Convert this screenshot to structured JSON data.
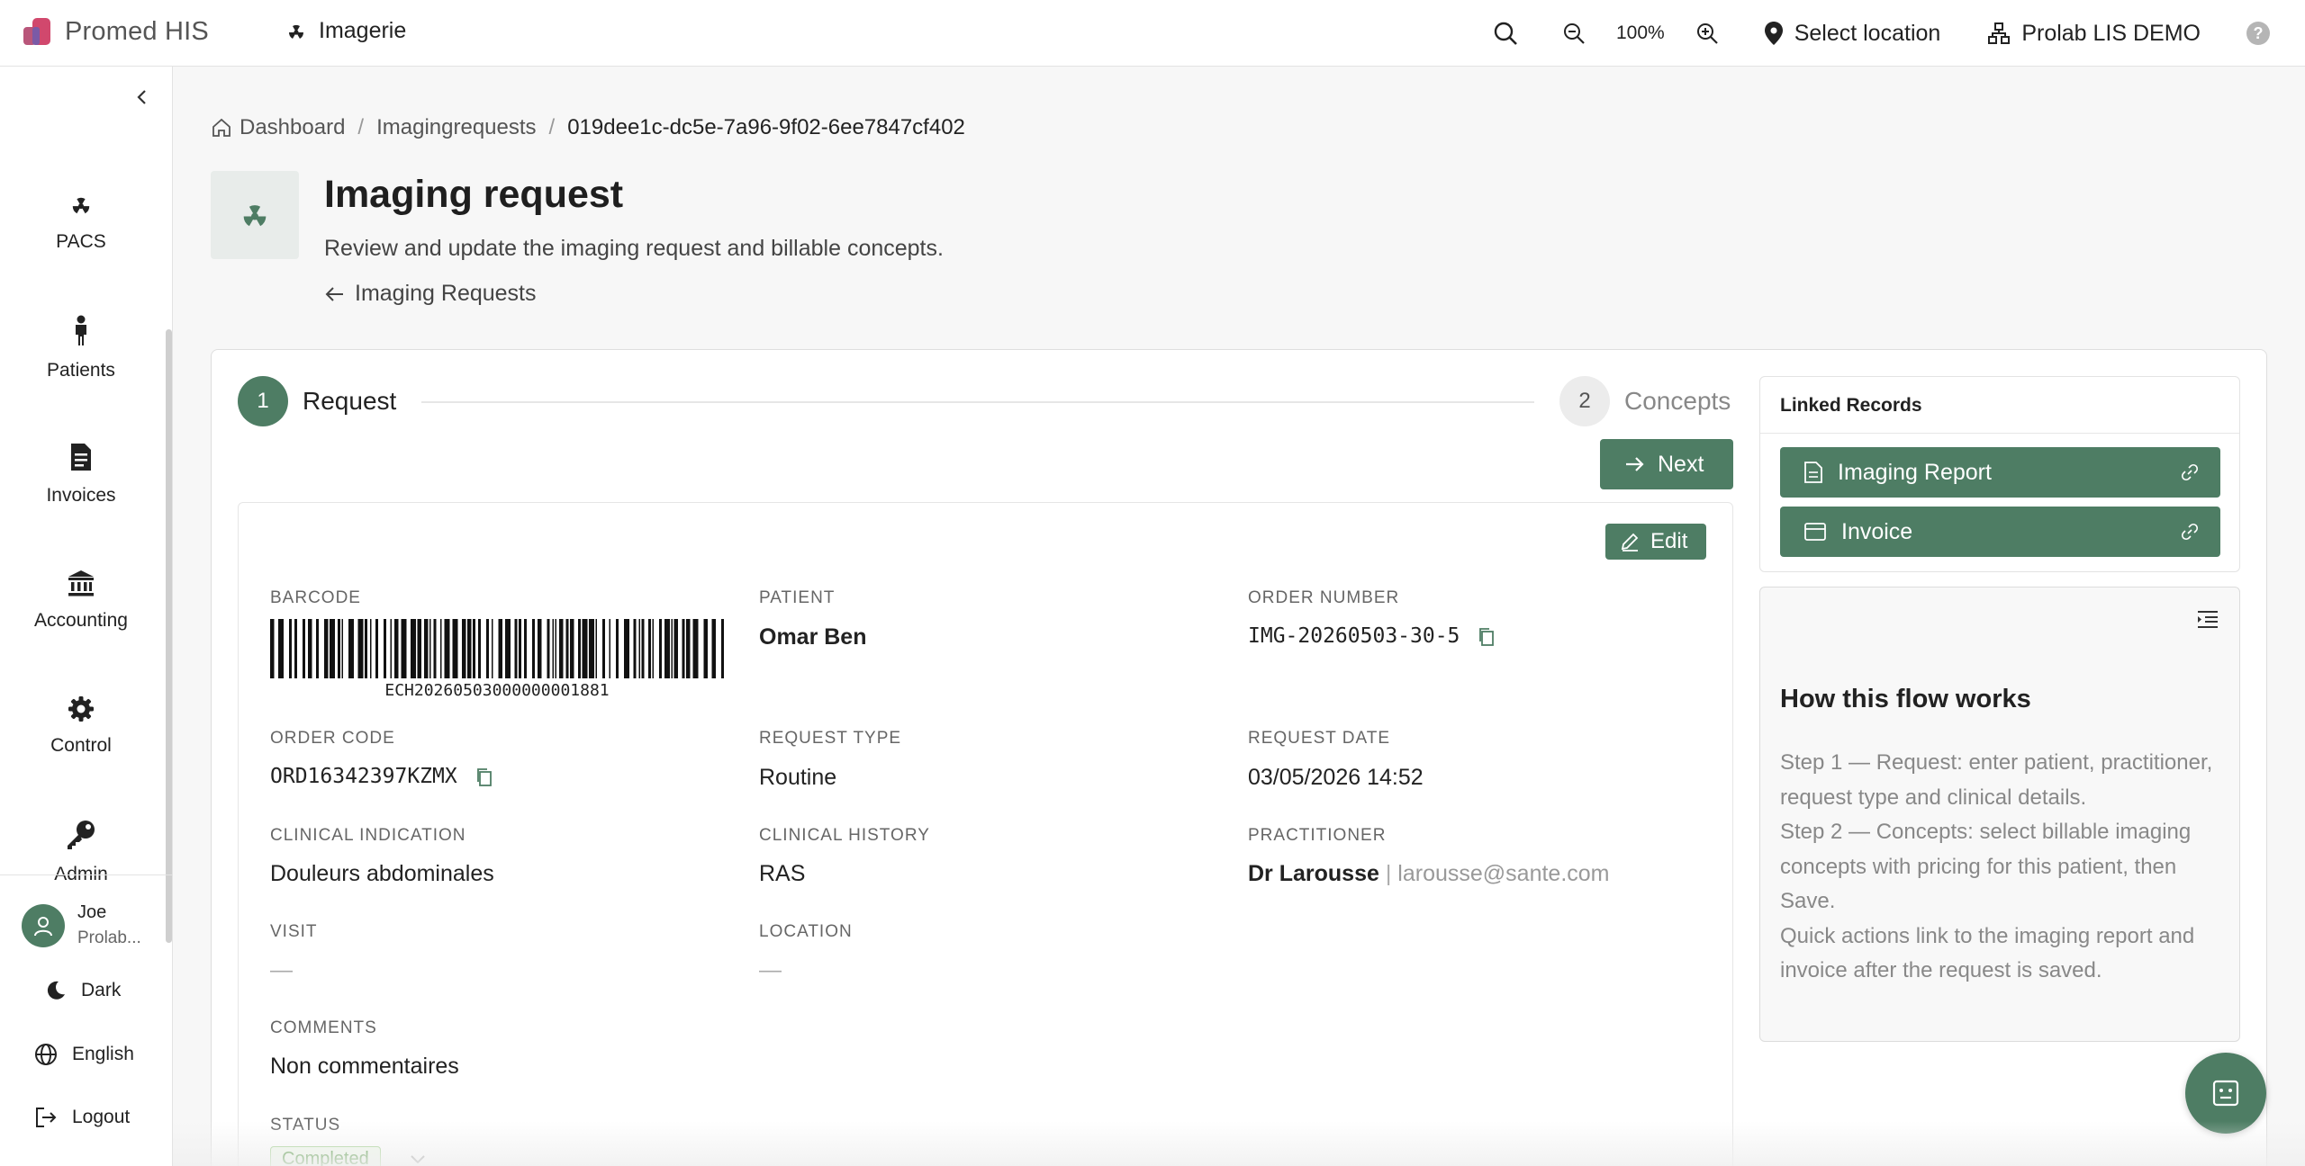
{
  "app": {
    "name": "Promed HIS",
    "module": "Imagerie"
  },
  "topbar": {
    "zoom": "100%",
    "location": "Select location",
    "lab": "Prolab LIS DEMO"
  },
  "sidebar": {
    "items": [
      {
        "label": "PACS",
        "icon": "radiation-icon"
      },
      {
        "label": "Patients",
        "icon": "person-icon"
      },
      {
        "label": "Invoices",
        "icon": "document-icon"
      },
      {
        "label": "Accounting",
        "icon": "bank-icon"
      },
      {
        "label": "Control",
        "icon": "gear-icon"
      },
      {
        "label": "Admin",
        "icon": "key-icon"
      }
    ],
    "user": {
      "name": "Joe",
      "org": "Prolab..."
    },
    "theme": "Dark",
    "language": "English",
    "logout": "Logout"
  },
  "breadcrumb": {
    "home": "Dashboard",
    "section": "Imagingrequests",
    "current": "019dee1c-dc5e-7a96-9f02-6ee7847cf402"
  },
  "header": {
    "title": "Imaging request",
    "subtitle": "Review and update the imaging request and billable concepts.",
    "back": "Imaging Requests"
  },
  "stepper": {
    "steps": [
      {
        "number": "1",
        "label": "Request"
      },
      {
        "number": "2",
        "label": "Concepts"
      }
    ],
    "next": "Next"
  },
  "detail": {
    "edit": "Edit",
    "barcode": {
      "label": "BARCODE",
      "value": "ECH20260503000000001881"
    },
    "patient": {
      "label": "PATIENT",
      "value": "Omar Ben"
    },
    "order_number": {
      "label": "ORDER NUMBER",
      "value": "IMG-20260503-30-5"
    },
    "order_code": {
      "label": "ORDER CODE",
      "value": "ORD16342397KZMX"
    },
    "request_type": {
      "label": "REQUEST TYPE",
      "value": "Routine"
    },
    "request_date": {
      "label": "REQUEST DATE",
      "value": "03/05/2026 14:52"
    },
    "clinical_indication": {
      "label": "CLINICAL INDICATION",
      "value": "Douleurs abdominales"
    },
    "clinical_history": {
      "label": "CLINICAL HISTORY",
      "value": "RAS"
    },
    "practitioner": {
      "label": "PRACTITIONER",
      "name": "Dr Larousse",
      "separator": "|",
      "email": "larousse@sante.com"
    },
    "visit": {
      "label": "VISIT",
      "value": "—"
    },
    "location": {
      "label": "LOCATION",
      "value": "—"
    },
    "comments": {
      "label": "COMMENTS",
      "value": "Non commentaires"
    },
    "status": {
      "label": "STATUS",
      "value": "Completed"
    }
  },
  "linked_records": {
    "title": "Linked Records",
    "items": [
      {
        "label": "Imaging Report"
      },
      {
        "label": "Invoice"
      }
    ]
  },
  "flow_help": {
    "title": "How this flow works",
    "lines": [
      "Step 1 — Request: enter patient, practitioner, request type and clinical details.",
      "Step 2 — Concepts: select billable imaging concepts with pricing for this patient, then Save.",
      "Quick actions link to the imaging report and invoice after the request is saved."
    ]
  },
  "colors": {
    "accent": "#4e7d64",
    "status_green": "#3d8a2a"
  }
}
